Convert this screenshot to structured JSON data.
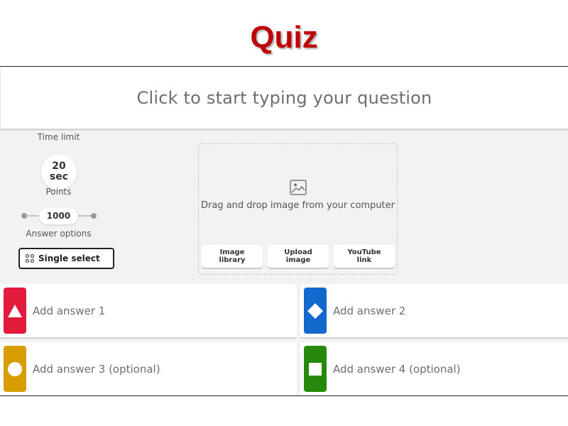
{
  "slide": {
    "title": "Quiz"
  },
  "question": {
    "placeholder": "Click to start typing your question"
  },
  "settings": {
    "time_limit_label": "Time limit",
    "time_limit_value": "20",
    "time_limit_unit": "sec",
    "points_label": "Points",
    "points_value": "1000",
    "answer_options_label": "Answer options",
    "answer_mode": "Single select"
  },
  "media": {
    "drop_text": "Drag and drop image from your computer",
    "buttons": [
      {
        "line1": "Image",
        "line2": "library"
      },
      {
        "line1": "Upload",
        "line2": "image"
      },
      {
        "line1": "YouTube",
        "line2": "link"
      }
    ]
  },
  "answers": [
    {
      "placeholder": "Add answer 1",
      "color": "#e21b3c",
      "shape_icon": "triangle-icon"
    },
    {
      "placeholder": "Add answer 2",
      "color": "#1368ce",
      "shape_icon": "diamond-icon"
    },
    {
      "placeholder": "Add answer 3 (optional)",
      "color": "#d89e00",
      "shape_icon": "circle-icon"
    },
    {
      "placeholder": "Add answer 4 (optional)",
      "color": "#26890c",
      "shape_icon": "square-icon"
    }
  ],
  "colors": {
    "title": "#c00000"
  }
}
